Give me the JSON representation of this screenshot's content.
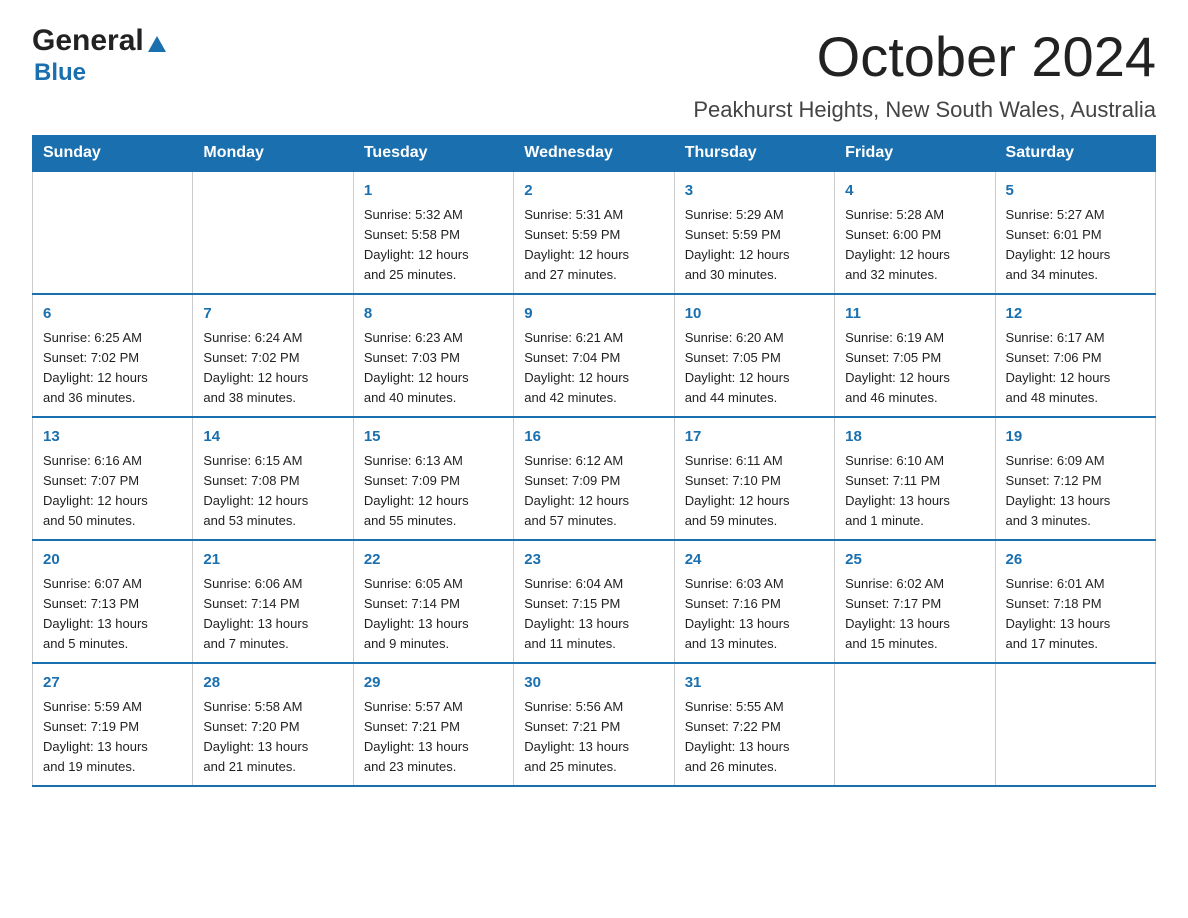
{
  "header": {
    "logo_general": "General",
    "logo_blue": "Blue",
    "month": "October 2024",
    "location": "Peakhurst Heights, New South Wales, Australia"
  },
  "days_of_week": [
    "Sunday",
    "Monday",
    "Tuesday",
    "Wednesday",
    "Thursday",
    "Friday",
    "Saturday"
  ],
  "weeks": [
    [
      {
        "day": "",
        "info": ""
      },
      {
        "day": "",
        "info": ""
      },
      {
        "day": "1",
        "info": "Sunrise: 5:32 AM\nSunset: 5:58 PM\nDaylight: 12 hours\nand 25 minutes."
      },
      {
        "day": "2",
        "info": "Sunrise: 5:31 AM\nSunset: 5:59 PM\nDaylight: 12 hours\nand 27 minutes."
      },
      {
        "day": "3",
        "info": "Sunrise: 5:29 AM\nSunset: 5:59 PM\nDaylight: 12 hours\nand 30 minutes."
      },
      {
        "day": "4",
        "info": "Sunrise: 5:28 AM\nSunset: 6:00 PM\nDaylight: 12 hours\nand 32 minutes."
      },
      {
        "day": "5",
        "info": "Sunrise: 5:27 AM\nSunset: 6:01 PM\nDaylight: 12 hours\nand 34 minutes."
      }
    ],
    [
      {
        "day": "6",
        "info": "Sunrise: 6:25 AM\nSunset: 7:02 PM\nDaylight: 12 hours\nand 36 minutes."
      },
      {
        "day": "7",
        "info": "Sunrise: 6:24 AM\nSunset: 7:02 PM\nDaylight: 12 hours\nand 38 minutes."
      },
      {
        "day": "8",
        "info": "Sunrise: 6:23 AM\nSunset: 7:03 PM\nDaylight: 12 hours\nand 40 minutes."
      },
      {
        "day": "9",
        "info": "Sunrise: 6:21 AM\nSunset: 7:04 PM\nDaylight: 12 hours\nand 42 minutes."
      },
      {
        "day": "10",
        "info": "Sunrise: 6:20 AM\nSunset: 7:05 PM\nDaylight: 12 hours\nand 44 minutes."
      },
      {
        "day": "11",
        "info": "Sunrise: 6:19 AM\nSunset: 7:05 PM\nDaylight: 12 hours\nand 46 minutes."
      },
      {
        "day": "12",
        "info": "Sunrise: 6:17 AM\nSunset: 7:06 PM\nDaylight: 12 hours\nand 48 minutes."
      }
    ],
    [
      {
        "day": "13",
        "info": "Sunrise: 6:16 AM\nSunset: 7:07 PM\nDaylight: 12 hours\nand 50 minutes."
      },
      {
        "day": "14",
        "info": "Sunrise: 6:15 AM\nSunset: 7:08 PM\nDaylight: 12 hours\nand 53 minutes."
      },
      {
        "day": "15",
        "info": "Sunrise: 6:13 AM\nSunset: 7:09 PM\nDaylight: 12 hours\nand 55 minutes."
      },
      {
        "day": "16",
        "info": "Sunrise: 6:12 AM\nSunset: 7:09 PM\nDaylight: 12 hours\nand 57 minutes."
      },
      {
        "day": "17",
        "info": "Sunrise: 6:11 AM\nSunset: 7:10 PM\nDaylight: 12 hours\nand 59 minutes."
      },
      {
        "day": "18",
        "info": "Sunrise: 6:10 AM\nSunset: 7:11 PM\nDaylight: 13 hours\nand 1 minute."
      },
      {
        "day": "19",
        "info": "Sunrise: 6:09 AM\nSunset: 7:12 PM\nDaylight: 13 hours\nand 3 minutes."
      }
    ],
    [
      {
        "day": "20",
        "info": "Sunrise: 6:07 AM\nSunset: 7:13 PM\nDaylight: 13 hours\nand 5 minutes."
      },
      {
        "day": "21",
        "info": "Sunrise: 6:06 AM\nSunset: 7:14 PM\nDaylight: 13 hours\nand 7 minutes."
      },
      {
        "day": "22",
        "info": "Sunrise: 6:05 AM\nSunset: 7:14 PM\nDaylight: 13 hours\nand 9 minutes."
      },
      {
        "day": "23",
        "info": "Sunrise: 6:04 AM\nSunset: 7:15 PM\nDaylight: 13 hours\nand 11 minutes."
      },
      {
        "day": "24",
        "info": "Sunrise: 6:03 AM\nSunset: 7:16 PM\nDaylight: 13 hours\nand 13 minutes."
      },
      {
        "day": "25",
        "info": "Sunrise: 6:02 AM\nSunset: 7:17 PM\nDaylight: 13 hours\nand 15 minutes."
      },
      {
        "day": "26",
        "info": "Sunrise: 6:01 AM\nSunset: 7:18 PM\nDaylight: 13 hours\nand 17 minutes."
      }
    ],
    [
      {
        "day": "27",
        "info": "Sunrise: 5:59 AM\nSunset: 7:19 PM\nDaylight: 13 hours\nand 19 minutes."
      },
      {
        "day": "28",
        "info": "Sunrise: 5:58 AM\nSunset: 7:20 PM\nDaylight: 13 hours\nand 21 minutes."
      },
      {
        "day": "29",
        "info": "Sunrise: 5:57 AM\nSunset: 7:21 PM\nDaylight: 13 hours\nand 23 minutes."
      },
      {
        "day": "30",
        "info": "Sunrise: 5:56 AM\nSunset: 7:21 PM\nDaylight: 13 hours\nand 25 minutes."
      },
      {
        "day": "31",
        "info": "Sunrise: 5:55 AM\nSunset: 7:22 PM\nDaylight: 13 hours\nand 26 minutes."
      },
      {
        "day": "",
        "info": ""
      },
      {
        "day": "",
        "info": ""
      }
    ]
  ]
}
